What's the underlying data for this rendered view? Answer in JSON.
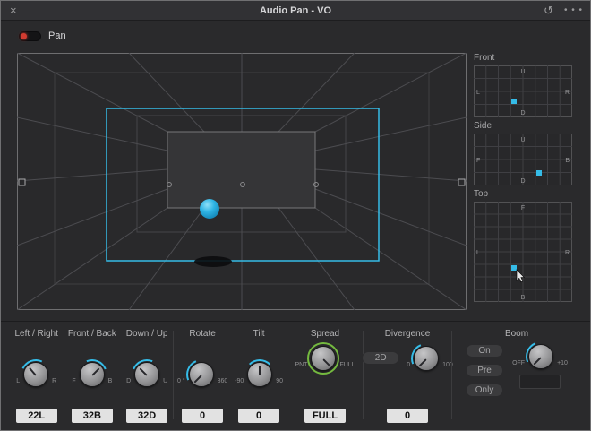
{
  "window": {
    "title": "Audio Pan - VO",
    "close": "×",
    "reset_icon": "↺",
    "menu_icon": "• • •"
  },
  "pan_toggle": {
    "label": "Pan",
    "enabled": true
  },
  "mini_views": {
    "front": {
      "title": "Front",
      "top": "U",
      "bottom": "D",
      "left": "L",
      "right": "R"
    },
    "side": {
      "title": "Side",
      "top": "U",
      "bottom": "D",
      "left": "F",
      "right": "B"
    },
    "top": {
      "title": "Top",
      "top": "F",
      "bottom": "B",
      "left": "L",
      "right": "R"
    }
  },
  "controls": {
    "left_right": {
      "label": "Left / Right",
      "min": "L",
      "max": "R",
      "value": "22L",
      "angle": -40
    },
    "front_back": {
      "label": "Front / Back",
      "min": "F",
      "max": "B",
      "value": "32B",
      "angle": 45
    },
    "down_up": {
      "label": "Down / Up",
      "min": "D",
      "max": "U",
      "value": "32D",
      "angle": -45
    },
    "rotate": {
      "label": "Rotate",
      "min": "0 °",
      "max": "360",
      "value": "0",
      "angle": -135
    },
    "tilt": {
      "label": "Tilt",
      "min": "-90",
      "max": "90",
      "value": "0",
      "angle": 0
    },
    "spread": {
      "label": "Spread",
      "min": "PNT",
      "max": "FULL",
      "value": "FULL",
      "angle": 135
    },
    "divergence": {
      "label": "Divergence",
      "button": "2D",
      "min": "0",
      "max": "100",
      "value": "0",
      "angle": -135
    },
    "boom": {
      "label": "Boom",
      "on": "On",
      "pre": "Pre",
      "only": "Only",
      "min": "OFF",
      "max": "+10",
      "value": "",
      "angle": -135
    }
  },
  "colors": {
    "accent": "#35bce8",
    "spread_ring": "#74b93f",
    "toggle_on": "#d23b30"
  }
}
